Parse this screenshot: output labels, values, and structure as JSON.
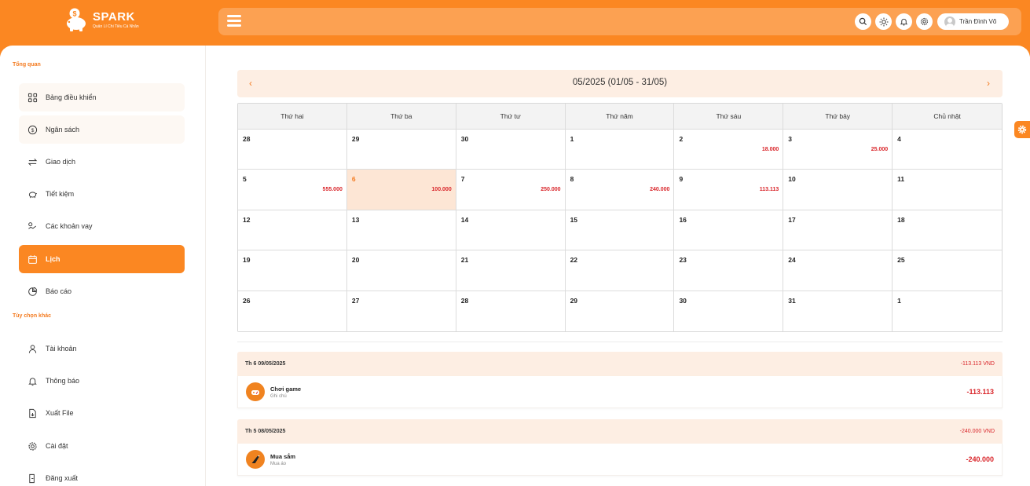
{
  "brand": {
    "name": "SPARK",
    "tagline": "Quản Lí Chi Tiêu Cá Nhân"
  },
  "topbar": {
    "menu_icon": "hamburger-icon",
    "icons": [
      "search-icon",
      "sun-icon",
      "bell-icon",
      "gear-icon"
    ],
    "user_name": "Trần Đình Võ"
  },
  "sidebar": {
    "section_overview": "Tổng quan",
    "section_other": "Tùy chọn khác",
    "items": [
      {
        "label": "Bảng điều khiển",
        "icon": "grid-icon"
      },
      {
        "label": "Ngân sách",
        "icon": "dollar-icon"
      },
      {
        "label": "Giao dịch",
        "icon": "swap-icon"
      },
      {
        "label": "Tiết kiệm",
        "icon": "piggy-bank-icon"
      },
      {
        "label": "Các khoản vay",
        "icon": "loan-icon"
      },
      {
        "label": "Lịch",
        "icon": "calendar-icon"
      },
      {
        "label": "Báo cáo",
        "icon": "pie-chart-icon"
      }
    ],
    "other_items": [
      {
        "label": "Tài khoản",
        "icon": "user-icon"
      },
      {
        "label": "Thông báo",
        "icon": "bell-icon"
      },
      {
        "label": "Xuất File",
        "icon": "file-export-icon"
      },
      {
        "label": "Cài đặt",
        "icon": "gear-icon"
      },
      {
        "label": "Đăng xuất",
        "icon": "logout-icon"
      }
    ]
  },
  "calendar": {
    "prev": "‹",
    "next": "›",
    "title": "05/2025 (01/05 - 31/05)",
    "weekdays": [
      "Thứ hai",
      "Thứ ba",
      "Thứ tư",
      "Thứ năm",
      "Thứ sáu",
      "Thứ bảy",
      "Chủ nhật"
    ],
    "weeks": [
      [
        {
          "d": "28",
          "a": ""
        },
        {
          "d": "29",
          "a": ""
        },
        {
          "d": "30",
          "a": ""
        },
        {
          "d": "1",
          "a": ""
        },
        {
          "d": "2",
          "a": "18.000"
        },
        {
          "d": "3",
          "a": "25.000"
        },
        {
          "d": "4",
          "a": ""
        }
      ],
      [
        {
          "d": "5",
          "a": "555.000"
        },
        {
          "d": "6",
          "a": "100.000",
          "today": true
        },
        {
          "d": "7",
          "a": "250.000"
        },
        {
          "d": "8",
          "a": "240.000"
        },
        {
          "d": "9",
          "a": "113.113"
        },
        {
          "d": "10",
          "a": ""
        },
        {
          "d": "11",
          "a": ""
        }
      ],
      [
        {
          "d": "12",
          "a": ""
        },
        {
          "d": "13",
          "a": ""
        },
        {
          "d": "14",
          "a": ""
        },
        {
          "d": "15",
          "a": ""
        },
        {
          "d": "16",
          "a": ""
        },
        {
          "d": "17",
          "a": ""
        },
        {
          "d": "18",
          "a": ""
        }
      ],
      [
        {
          "d": "19",
          "a": ""
        },
        {
          "d": "20",
          "a": ""
        },
        {
          "d": "21",
          "a": ""
        },
        {
          "d": "22",
          "a": ""
        },
        {
          "d": "23",
          "a": ""
        },
        {
          "d": "24",
          "a": ""
        },
        {
          "d": "25",
          "a": ""
        }
      ],
      [
        {
          "d": "26",
          "a": ""
        },
        {
          "d": "27",
          "a": ""
        },
        {
          "d": "28",
          "a": ""
        },
        {
          "d": "29",
          "a": ""
        },
        {
          "d": "30",
          "a": ""
        },
        {
          "d": "31",
          "a": ""
        },
        {
          "d": "1",
          "a": ""
        }
      ]
    ]
  },
  "transactions": [
    {
      "date": "Th 6 09/05/2025",
      "sum": "-113.113 VND",
      "name": "Chơi game",
      "note": "Ghi chú",
      "amount": "-113.113",
      "icon": "game-icon"
    },
    {
      "date": "Th 5 08/05/2025",
      "sum": "-240.000 VND",
      "name": "Mua sắm",
      "note": "Mua áo",
      "amount": "-240.000",
      "icon": "shopping-icon"
    }
  ],
  "colors": {
    "accent": "#fb8722",
    "negative": "#d9252a",
    "soft": "#fdeee3"
  }
}
